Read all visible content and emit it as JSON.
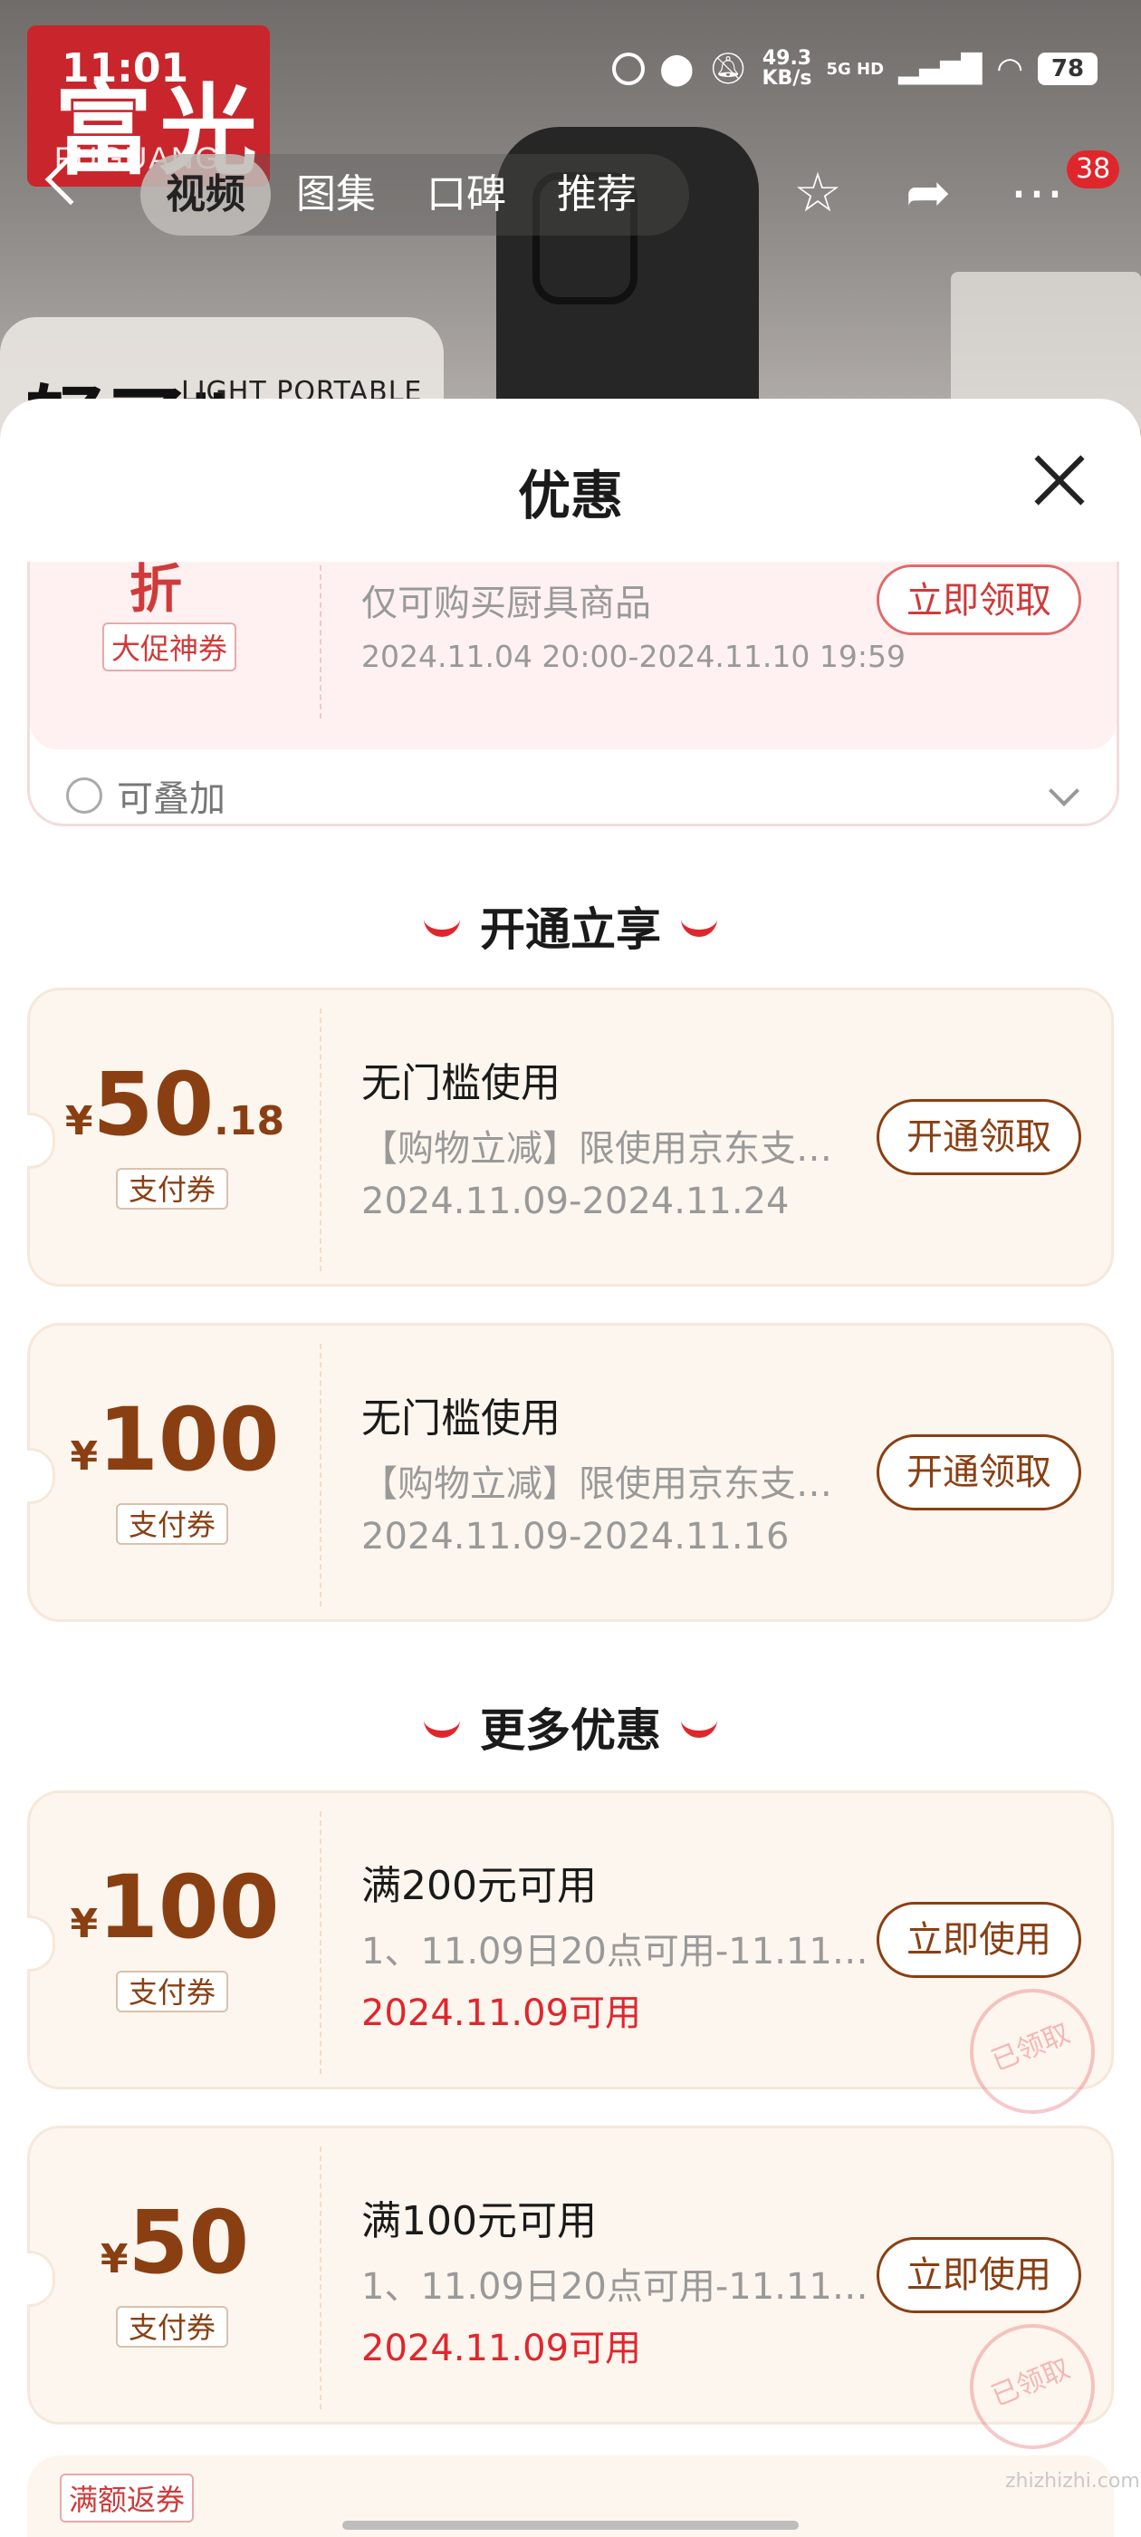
{
  "status_bar": {
    "time": "11:01",
    "speed_value": "49.3",
    "speed_unit": "KB/s",
    "network": "5G HD",
    "battery": "78"
  },
  "background": {
    "logo_big": "富光",
    "logo_small": "FUGUANG",
    "hero_text": "LIGHT PORTABLE",
    "hero_big": "轻了\""
  },
  "nav": {
    "tabs": [
      "视频",
      "图集",
      "口碑",
      "推荐"
    ],
    "active_tab": 0,
    "more_badge": "38"
  },
  "sheet": {
    "title": "优惠"
  },
  "promo_coupon": {
    "discount": "折",
    "tag": "大促神券",
    "desc": "仅可购买厨具商品",
    "date": "2024.11.04 20:00-2024.11.10 19:59",
    "button": "立即领取",
    "stackable": "可叠加"
  },
  "sections": {
    "open": "开通立享",
    "more": "更多优惠"
  },
  "coupons": [
    {
      "currency": "¥",
      "amount": "50",
      "decimal": ".18",
      "type": "支付券",
      "title": "无门槛使用",
      "desc": "【购物立减】限使用京东支…",
      "date": "2024.11.09-2024.11.24",
      "button": "开通领取",
      "date_red": false,
      "claimed": false
    },
    {
      "currency": "¥",
      "amount": "100",
      "decimal": "",
      "type": "支付券",
      "title": "无门槛使用",
      "desc": "【购物立减】限使用京东支…",
      "date": "2024.11.09-2024.11.16",
      "button": "开通领取",
      "date_red": false,
      "claimed": false
    },
    {
      "currency": "¥",
      "amount": "100",
      "decimal": "",
      "type": "支付券",
      "title": "满200元可用",
      "desc": "1、11.09日20点可用-11.11…",
      "date": "2024.11.09可用",
      "button": "立即使用",
      "date_red": true,
      "claimed": true
    },
    {
      "currency": "¥",
      "amount": "50",
      "decimal": "",
      "type": "支付券",
      "title": "满100元可用",
      "desc": "1、11.09日20点可用-11.11…",
      "date": "2024.11.09可用",
      "button": "立即使用",
      "date_red": true,
      "claimed": true
    }
  ],
  "claimed_stamp": "已领取",
  "bottom_tag": "满额返券",
  "watermark": "zhizhizhi.com",
  "colors": {
    "accent_red": "#e0262d",
    "coupon_brown": "#8a3f12",
    "coupon_bg": "#fdf6ee"
  }
}
